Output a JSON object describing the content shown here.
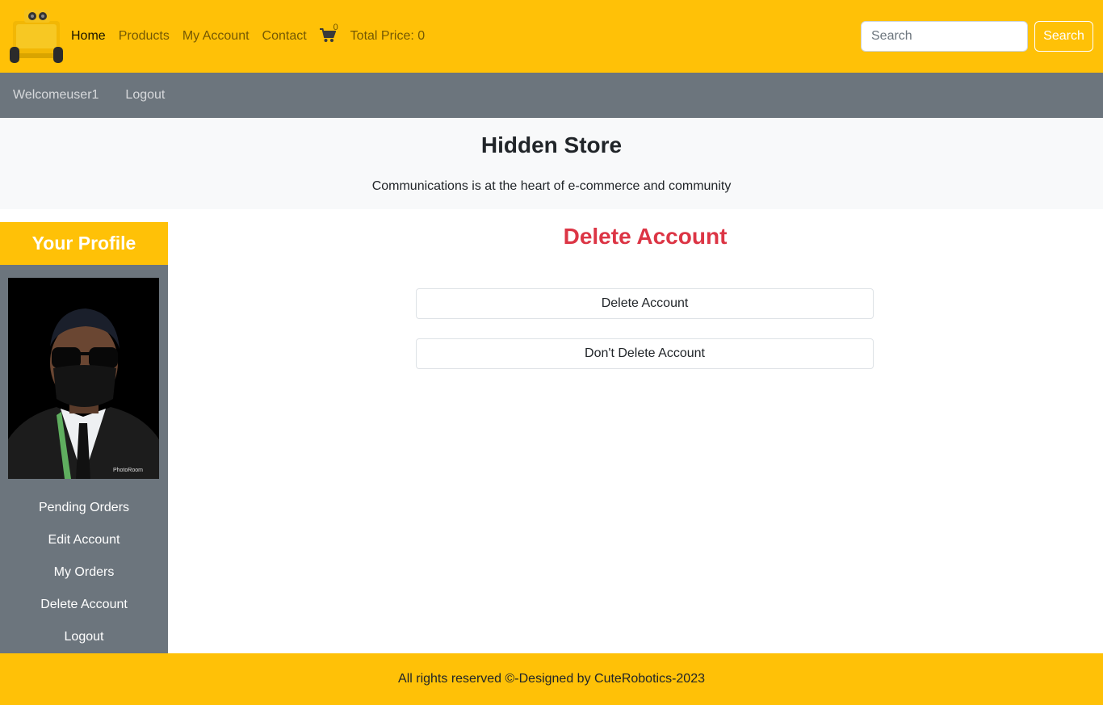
{
  "navbar": {
    "logo_icon": "robot-logo-icon",
    "links": [
      {
        "label": "Home",
        "active": true
      },
      {
        "label": "Products",
        "active": false
      },
      {
        "label": "My Account",
        "active": false
      },
      {
        "label": "Contact",
        "active": false
      }
    ],
    "cart_icon": "shopping-cart-icon",
    "cart_count": "0",
    "total_price": "Total Price: 0",
    "search_placeholder": "Search",
    "search_button": "Search",
    "background_color": "#ffc107"
  },
  "subnav": {
    "welcome": "Welcomeuser1",
    "logout": "Logout",
    "background_color": "#6c757d"
  },
  "hero": {
    "title": "Hidden Store",
    "subtitle": "Communications is at the heart of e-commerce and community"
  },
  "sidebar": {
    "header": "Your Profile",
    "items": [
      {
        "label": "Pending Orders"
      },
      {
        "label": "Edit Account"
      },
      {
        "label": "My Orders"
      },
      {
        "label": "Delete Account"
      },
      {
        "label": "Logout"
      }
    ]
  },
  "main": {
    "title": "Delete Account",
    "title_color": "#dc3545",
    "delete_button": "Delete Account",
    "keep_button": "Don't Delete Account"
  },
  "footer": {
    "text": "All rights reserved ©-Designed by CuteRobotics-2023"
  }
}
